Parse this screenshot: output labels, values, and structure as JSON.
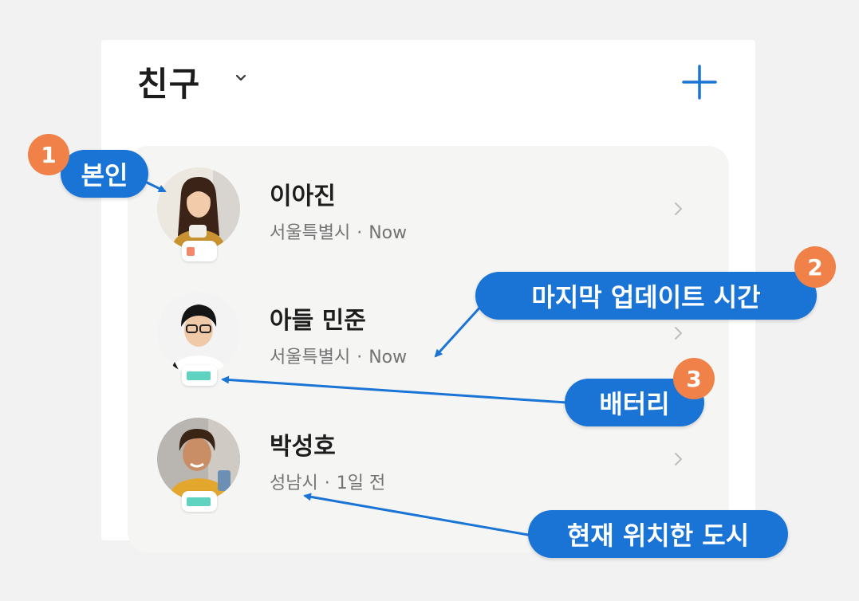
{
  "header": {
    "title": "친구",
    "chevron_icon": "chevron-down-icon",
    "add_icon": "plus-icon"
  },
  "friends": [
    {
      "name": "이아진",
      "city": "서울특별시",
      "separator": "·",
      "time": "Now",
      "battery_level": 0.3,
      "battery_color": "#f4866a"
    },
    {
      "name": "아들 민준",
      "city": "서울특별시",
      "separator": "·",
      "time": "Now",
      "battery_level": 0.95,
      "battery_color": "#5fd3bf"
    },
    {
      "name": "박성호",
      "city": "성남시",
      "separator": "·",
      "time": "1일 전",
      "battery_level": 0.95,
      "battery_color": "#5fd3bf"
    }
  ],
  "callouts": {
    "self": {
      "number": "1",
      "label": "본인"
    },
    "last_update": {
      "number": "2",
      "label": "마지막 업데이트 시간"
    },
    "battery": {
      "number": "3",
      "label": "배터리"
    },
    "city": {
      "label": "현재 위치한 도시"
    }
  },
  "colors": {
    "accent": "#1a74d6",
    "badge": "#f08148",
    "card_bg": "#f5f5f4"
  }
}
